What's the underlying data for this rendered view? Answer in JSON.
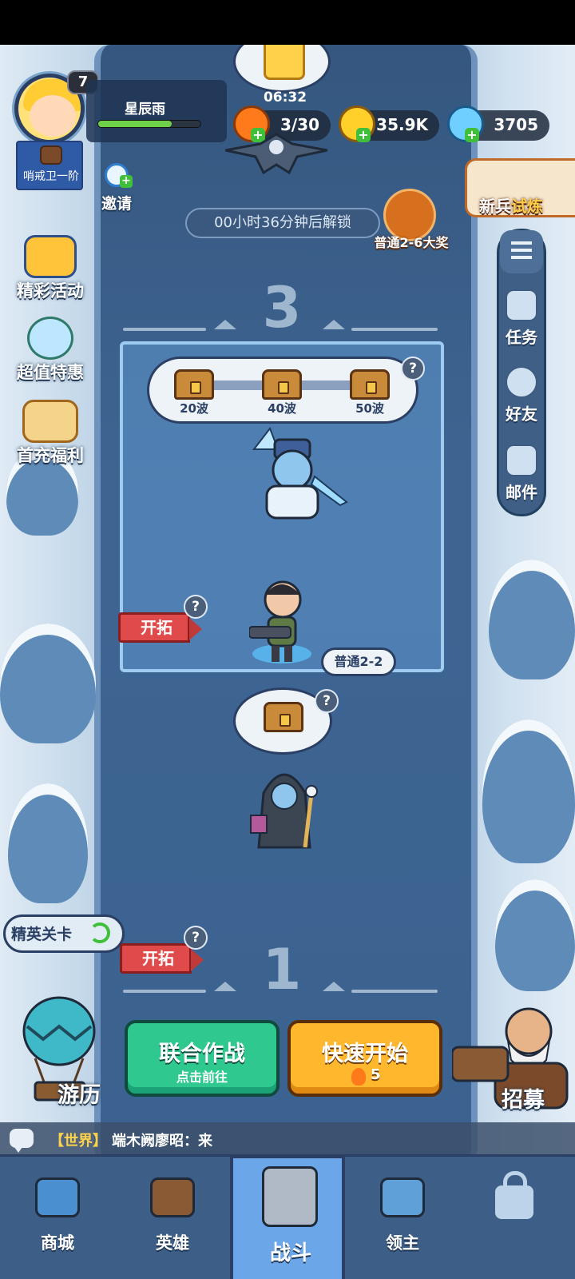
{
  "player": {
    "level": "7",
    "name": "星辰雨",
    "rank": "哨戒卫一阶",
    "hp_fraction": 0.72
  },
  "header": {
    "timer": "06:32",
    "invite_label": "邀请",
    "unlock_text": "00小时36分钟后解锁",
    "reward_text": "普通2-6大奖"
  },
  "resources": {
    "stamina": "3/30",
    "gold": "35.9K",
    "gems": "3705"
  },
  "left_menu": [
    {
      "label": "精彩活动"
    },
    {
      "label": "超值特惠"
    },
    {
      "label": "首充福利"
    }
  ],
  "right_menu": {
    "newbie_prefix": "新兵",
    "newbie_suffix": "试炼",
    "items": [
      {
        "label": "任务"
      },
      {
        "label": "好友"
      },
      {
        "label": "邮件"
      }
    ]
  },
  "stage_top": {
    "number": "3",
    "waves": [
      "20波",
      "40波",
      "50波"
    ],
    "help": "?",
    "explore_label": "开拓",
    "current_level": "普通2-2"
  },
  "stage_bottom": {
    "number": "1",
    "help": "?",
    "explore_label": "开拓",
    "elite_label": "精英关卡"
  },
  "actions": {
    "coop_title": "联合作战",
    "coop_sub": "点击前往",
    "quick_title": "快速开始",
    "quick_cost": "5",
    "travel_label": "游历",
    "recruit_label": "招募"
  },
  "chat": {
    "channel": "【世界】",
    "message": "端木阙廖昭：来"
  },
  "nav": {
    "items": [
      {
        "label": "商城"
      },
      {
        "label": "英雄"
      },
      {
        "label": "战斗"
      },
      {
        "label": "领主"
      }
    ]
  },
  "colors": {
    "river": "#3e6592",
    "accent_green": "#2fc88e",
    "accent_orange": "#ffb82e",
    "flag_red": "#e14a4a"
  }
}
